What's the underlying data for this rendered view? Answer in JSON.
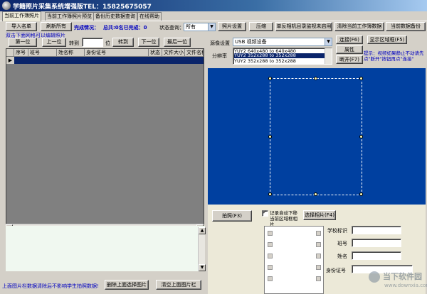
{
  "window": {
    "title": "学籍照片采集系统增强版TEL：15825675057"
  },
  "tabs": [
    {
      "label": "当前工作簿照片",
      "active": true
    },
    {
      "label": "当前工作簿照片预览",
      "active": false
    },
    {
      "label": "备份历史数据查询",
      "active": false
    },
    {
      "label": "在线帮助",
      "active": false
    }
  ],
  "toolbar": {
    "import_label": "导入名单",
    "refresh_label": "刷新所有",
    "completion_label": "完成情况：",
    "completion_value": "总共:0名已完成：0",
    "status_query_label": "状态查询：",
    "status_query_value": "所有",
    "photo_settings_label": "照片设置",
    "compress_label": "压缩",
    "notebook_camera_label": "单反相机目录监视未启用",
    "clear_workbook_label": "清除当前工作簿数据",
    "backup_label": "当前数据备份"
  },
  "hint": {
    "edit_photo": "双击下面网格可以编辑照片"
  },
  "nav": {
    "first_label": "第一位",
    "prev_label": "上一位",
    "goto_label": "转到",
    "goto_value": "",
    "position_suffix": "位",
    "jump_label": "转到",
    "next_label": "下一位",
    "last_label": "最后一位"
  },
  "grid": {
    "columns": [
      "序号",
      "班号",
      "姓名称",
      "身份证号",
      "状态",
      "文件大小",
      "文件名称"
    ],
    "row_indicator": "▶"
  },
  "camera": {
    "source_label": "源像设置",
    "source_value": "USB 视频设备",
    "resolution_label": "分辨率",
    "resolutions": [
      "YUY2 640x480 to 640x480",
      "YUY2 352x288 to 352x288",
      "YUY2 352x288 to 352x288"
    ],
    "selected_resolution_index": 1,
    "connect_label": "连接(F6)",
    "show_area_label": "显示区域框(F5)",
    "property_label": "属性",
    "disconnect_label": "断开(F7)",
    "tip": "提示：视频如果静止不动请先点\"断开\"按钮再点\"连接\""
  },
  "capture": {
    "shoot_label": "拍照(F3)",
    "auto_next_label": "记录自动下移当前区域框相片",
    "auto_next_checked": true,
    "select_photo_label": "选择相片(F4)"
  },
  "student_info": {
    "school_id_label": "学校标识",
    "class_label": "班号",
    "name_label": "姓名",
    "id_label": "身份证号",
    "school_id_value": "",
    "class_value": "",
    "name_value": "",
    "id_value": ""
  },
  "bottom": {
    "reminder": "上面图片栏数据清除后不影响学生拍照数据!",
    "delete_selected_label": "删除上面选择图片",
    "clear_all_label": "清空上面图片栏"
  },
  "watermark": {
    "site": "当下软件园",
    "url": "www.downxia.com"
  },
  "colors": {
    "preview_bg": "#0040a0",
    "title_bar": "#0a246a",
    "accent_blue": "#0000c0"
  }
}
